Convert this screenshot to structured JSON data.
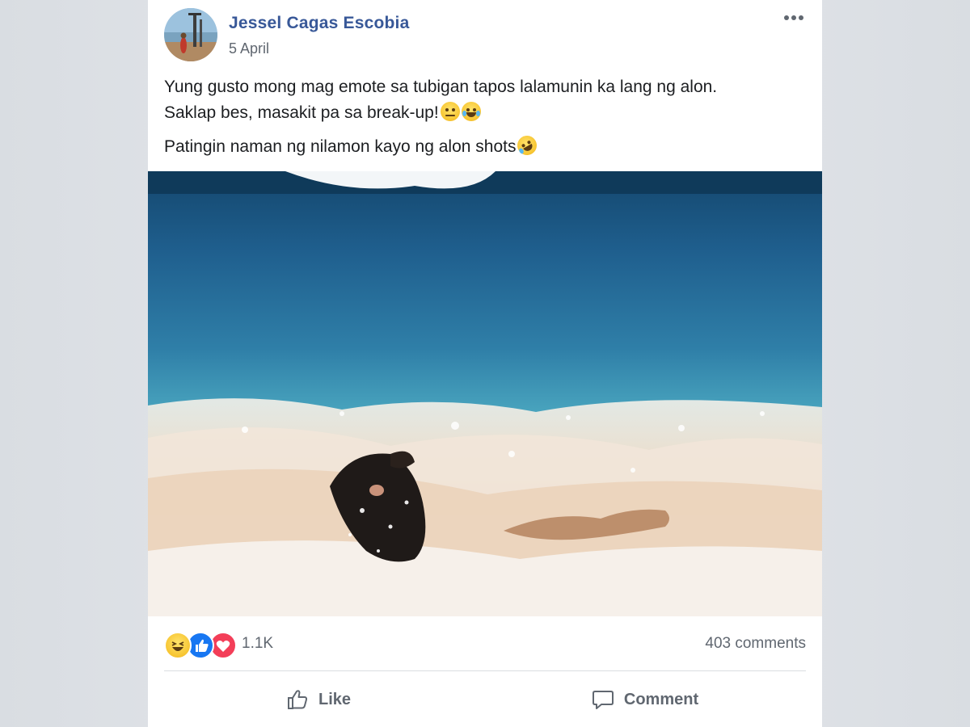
{
  "post": {
    "author": "Jessel Cagas Escobia",
    "date": "5 April",
    "text_line1": "Yung gusto mong mag emote sa tubigan tapos lalamunin ka lang ng alon.",
    "text_line2": "Saklap bes, masakit pa sa break-up!",
    "text_line2_emojis": [
      "face-with-rolling-eyes",
      "face-with-tears-of-joy"
    ],
    "text_line3": "Patingin naman ng nilamon kayo ng alon shots",
    "text_line3_emojis": [
      "rolling-on-the-floor-laughing"
    ]
  },
  "reactions": {
    "types": [
      "haha",
      "like",
      "love"
    ],
    "count": "1.1K",
    "comments": "403 comments"
  },
  "actions": {
    "like_label": "Like",
    "comment_label": "Comment"
  },
  "colors": {
    "author_link": "#385898",
    "secondary_text": "#606770",
    "like_blue": "#1877f2",
    "love_red": "#f33e58",
    "haha_yellow": "#f7c531"
  }
}
